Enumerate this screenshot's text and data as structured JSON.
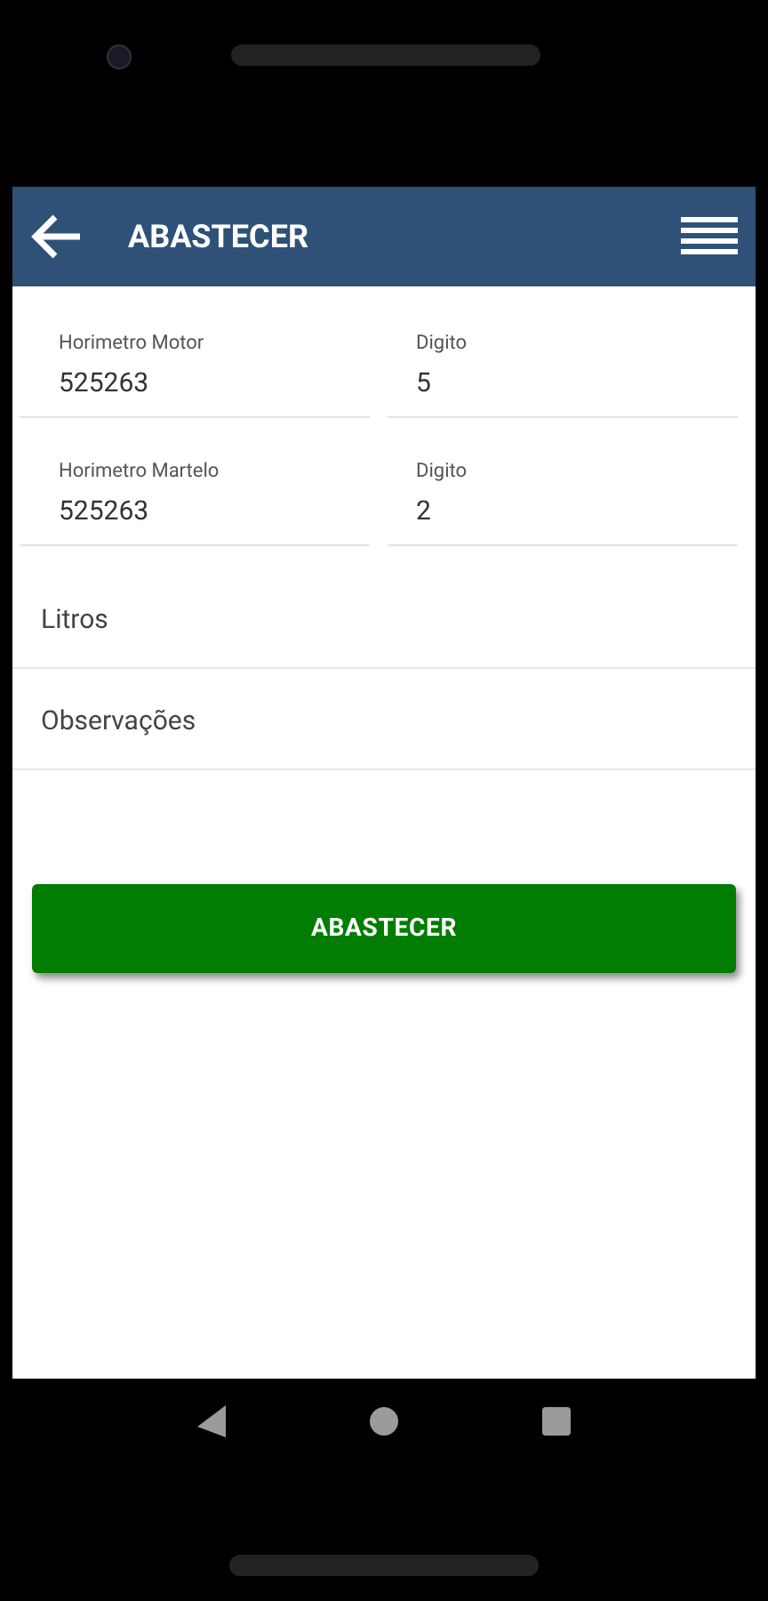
{
  "header": {
    "title": "ABASTECER"
  },
  "fields": [
    {
      "label": "Horimetro Motor",
      "value": "525263"
    },
    {
      "label": "Digito",
      "value": "5"
    },
    {
      "label": "Horimetro Martelo",
      "value": "525263"
    },
    {
      "label": "Digito",
      "value": "2"
    }
  ],
  "text_fields": [
    {
      "placeholder": "Litros"
    },
    {
      "placeholder": "Observações"
    }
  ],
  "submit_button": {
    "label": "ABASTECER"
  }
}
